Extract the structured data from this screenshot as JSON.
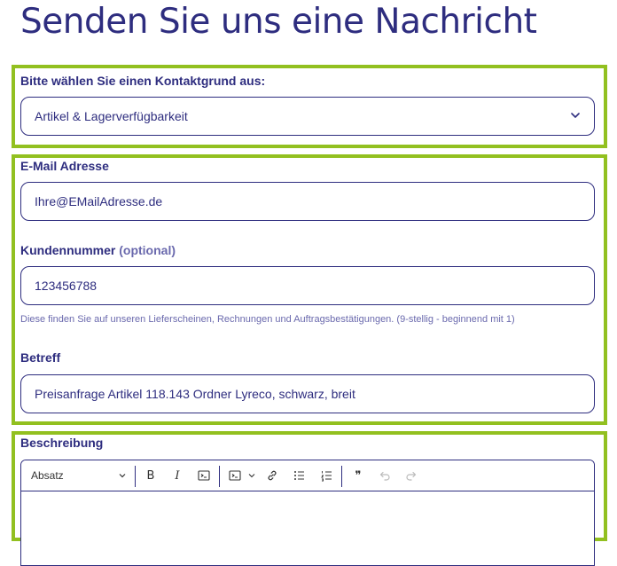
{
  "page": {
    "title": "Senden Sie uns eine Nachricht"
  },
  "contact_reason": {
    "label": "Bitte wählen Sie einen Kontaktgrund aus:",
    "selected": "Artikel & Lagerverfügbarkeit"
  },
  "email": {
    "label": "E-Mail Adresse",
    "value": "Ihre@EMailAdresse.de"
  },
  "customer_number": {
    "label": "Kundennummer",
    "optional_label": "(optional)",
    "value": "123456788",
    "hint": "Diese finden Sie auf unseren Lieferscheinen, Rechnungen und Auftragsbestätigungen. (9-stellig - beginnend mit 1)"
  },
  "subject": {
    "label": "Betreff",
    "value": "Preisanfrage Artikel 118.143 Ordner Lyreco, schwarz, breit"
  },
  "description": {
    "label": "Beschreibung",
    "toolbar": {
      "paragraph_style": "Absatz",
      "bold_glyph": "B",
      "italic_glyph": "I",
      "quote_glyph": "❞"
    }
  },
  "colors": {
    "primary": "#2e2d7f",
    "highlight_border": "#92c020",
    "hint": "#6a69ad"
  },
  "icons": {
    "dropdown": "chevron-down-icon",
    "editor": [
      "bold-icon",
      "italic-icon",
      "code-icon",
      "code-block-icon",
      "link-icon",
      "bulleted-list-icon",
      "numbered-list-icon",
      "quote-icon",
      "undo-icon",
      "redo-icon"
    ]
  }
}
